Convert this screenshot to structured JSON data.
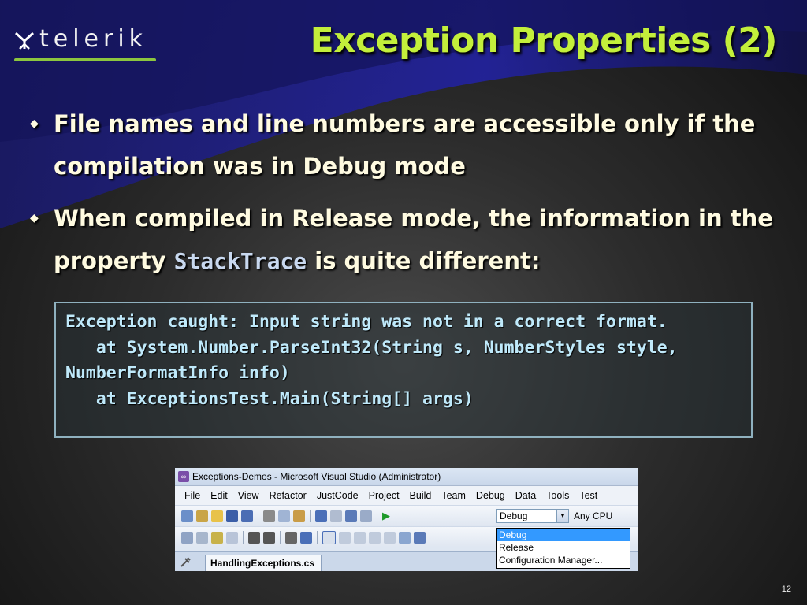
{
  "logo": {
    "text": "telerik",
    "accent_color": "#8cc63f"
  },
  "title": "Exception Properties (2)",
  "title_color": "#c3ef3b",
  "bullets": [
    {
      "text": "File names and line numbers are accessible only if the compilation was in Debug mode"
    },
    {
      "text_before": "When compiled in Release mode, the information in the property ",
      "code": "StackTrace",
      "text_after": " is quite different:"
    }
  ],
  "code_block": {
    "lines": [
      "Exception caught: Input string was not in a correct format.",
      "   at System.Number.ParseInt32(String s, NumberStyles style, NumberFormatInfo info)",
      "   at ExceptionsTest.Main(String[] args)"
    ]
  },
  "vs_screenshot": {
    "window_title": "Exceptions-Demos - Microsoft Visual Studio (Administrator)",
    "menu": [
      "File",
      "Edit",
      "View",
      "Refactor",
      "JustCode",
      "Project",
      "Build",
      "Team",
      "Debug",
      "Data",
      "Tools",
      "Test"
    ],
    "config_combo_value": "Debug",
    "platform_value": "Any CPU",
    "dropdown_options": [
      "Debug",
      "Release",
      "Configuration Manager..."
    ],
    "selected_option": "Debug",
    "tab_label": "HandlingExceptions.cs"
  },
  "slide_number": "12"
}
